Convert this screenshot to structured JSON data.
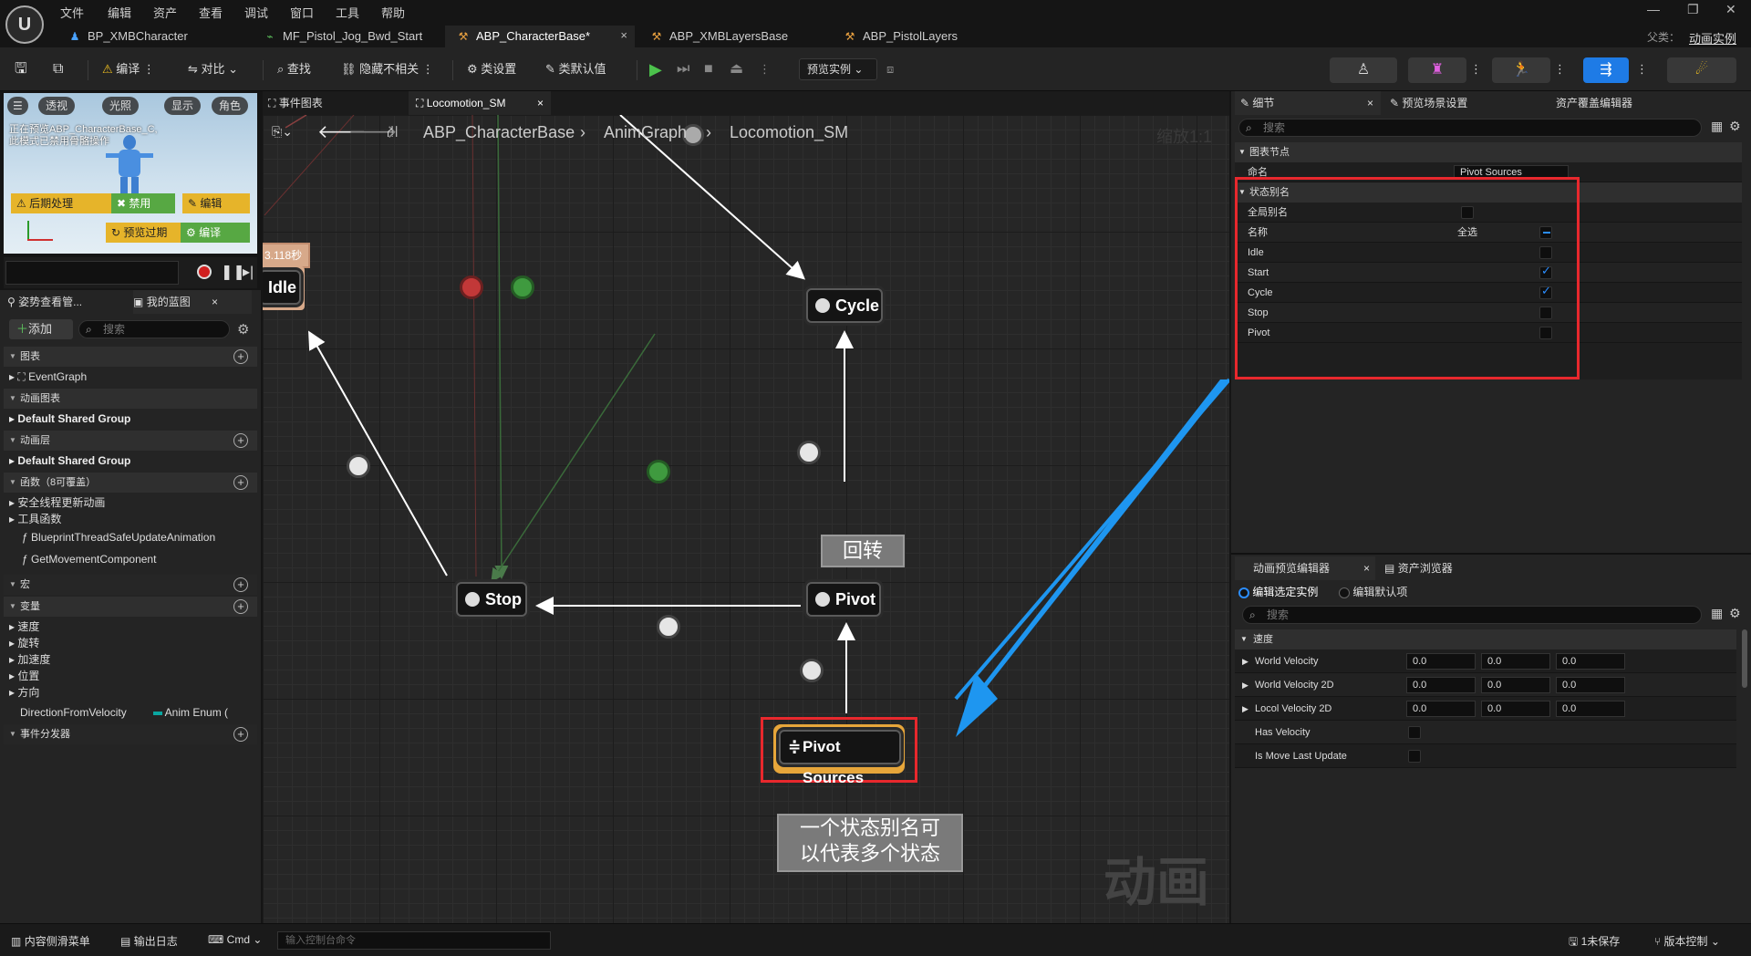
{
  "menu": [
    "文件",
    "编辑",
    "资产",
    "查看",
    "调试",
    "窗口",
    "工具",
    "帮助"
  ],
  "doc_tabs": [
    "BP_XMBCharacter",
    "MF_Pistol_Jog_Bwd_Start",
    "ABP_CharacterBase*",
    "ABP_XMBLayersBase",
    "ABP_PistolLayers"
  ],
  "parent_label": "父类：",
  "parent_value": "动画实例",
  "toolbar": {
    "compile": "编译",
    "diff": "对比",
    "find": "查找",
    "hide_unrelated": "隐藏不相关",
    "class_settings": "类设置",
    "class_defaults": "类默认值",
    "preview_instance": "预览实例"
  },
  "viewport": {
    "buttons": [
      "透视",
      "光照",
      "显示",
      "角色"
    ],
    "warning_line1": "正在预览ABP_CharacterBase_C,",
    "warning_line2": "此模式已禁用骨骼操作",
    "postprocess": "后期处理",
    "disable": "禁用",
    "edit": "编辑",
    "preview_expired": "预览过期",
    "compile": "编译"
  },
  "left_panel": {
    "tab1": "姿势查看管...",
    "tab2": "我的蓝图",
    "add": "添加",
    "search_placeholder": "搜索",
    "graphs": "图表",
    "event_graph": "EventGraph",
    "anim_graphs": "动画图表",
    "default_shared_group_1": "Default Shared Group",
    "anim_layers": "动画层",
    "default_shared_group_2": "Default Shared Group",
    "functions": "函数（8可覆盖）",
    "thread_safe": "安全线程更新动画",
    "utility": "工具函数",
    "fn1": "BlueprintThreadSafeUpdateAnimation",
    "fn2": "GetMovementComponent",
    "macros": "宏",
    "variables": "变量",
    "var_cats": [
      "速度",
      "旋转",
      "加速度",
      "位置",
      "方向"
    ],
    "direction_var": "DirectionFromVelocity",
    "direction_type": "Anim Enum (",
    "dispatchers": "事件分发器"
  },
  "graph": {
    "tab1": "事件图表",
    "tab2": "Locomotion_SM",
    "breadcrumb": [
      "ABP_CharacterBase",
      "AnimGraph",
      "Locomotion_SM"
    ],
    "zoom": "缩放1:1",
    "time_label": "3.118秒",
    "nodes": {
      "idle": "Idle",
      "cycle": "Cycle",
      "stop": "Stop",
      "pivot": "Pivot",
      "pivot_sources": "Pivot Sources"
    },
    "comment_pivot": "回转",
    "comment_alias_line1": "一个状态别名可",
    "comment_alias_line2": "以代表多个状态",
    "watermark": "动画"
  },
  "details": {
    "tab1": "细节",
    "tab2": "预览场景设置",
    "tab3": "资产覆盖编辑器",
    "search_placeholder": "搜索",
    "section_graph_node": "图表节点",
    "name_label": "命名",
    "name_value": "Pivot Sources",
    "section_alias": "状态别名",
    "global_alias": "全局别名",
    "name_col": "名称",
    "select_all": "全选",
    "states": [
      {
        "name": "Idle",
        "checked": false
      },
      {
        "name": "Start",
        "checked": true
      },
      {
        "name": "Cycle",
        "checked": true
      },
      {
        "name": "Stop",
        "checked": false
      },
      {
        "name": "Pivot",
        "checked": false
      }
    ]
  },
  "anim_preview": {
    "tab1": "动画预览编辑器",
    "tab2": "资产浏览器",
    "radio1": "编辑选定实例",
    "radio2": "编辑默认项",
    "search_placeholder": "搜索",
    "section_speed": "速度",
    "rows": [
      {
        "label": "World Velocity",
        "values": [
          "0.0",
          "0.0",
          "0.0"
        ]
      },
      {
        "label": "World Velocity 2D",
        "values": [
          "0.0",
          "0.0",
          "0.0"
        ]
      },
      {
        "label": "Locol Velocity 2D",
        "values": [
          "0.0",
          "0.0",
          "0.0"
        ]
      }
    ],
    "has_velocity": "Has Velocity",
    "is_move_last_update": "Is Move Last Update"
  },
  "statusbar": {
    "content_drawer": "内容侧滑菜单",
    "output_log": "输出日志",
    "cmd": "Cmd",
    "console_placeholder": "输入控制台命令",
    "unsaved": "1未保存",
    "source_control": "版本控制"
  },
  "colors": {
    "accent_blue": "#2b8dff",
    "highlight_red": "#e8282d",
    "arrow_blue": "#1e96f0"
  }
}
